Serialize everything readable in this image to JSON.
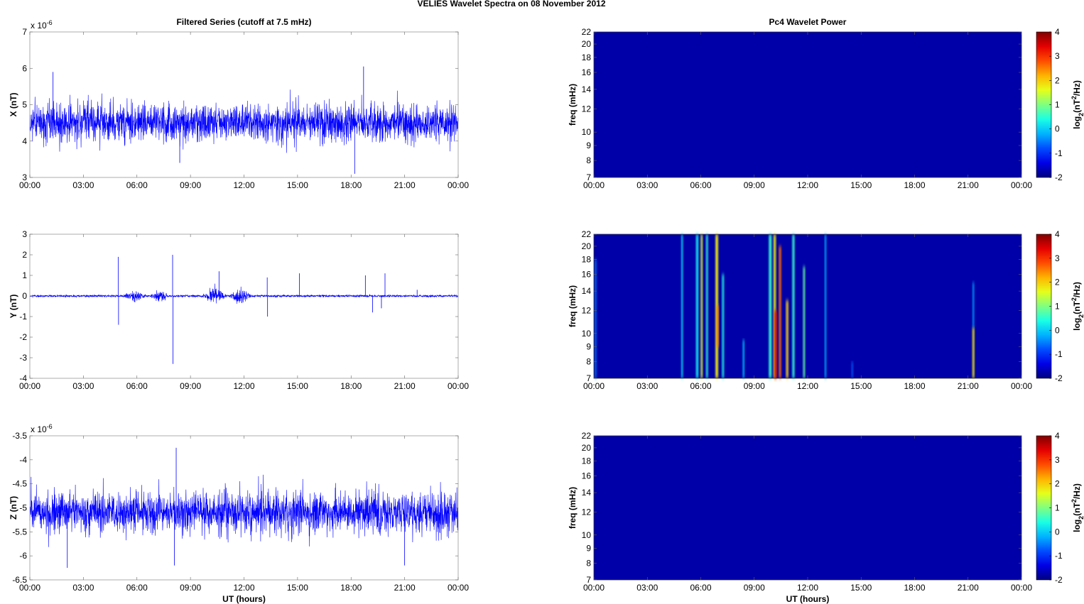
{
  "title": "VELIES Wavelet Spectra on 08 November  2012",
  "chart_data": [
    {
      "type": "line",
      "panel": "X",
      "title": "Filtered Series (cutoff at 7.5 mHz)",
      "ylabel": "X (nT)",
      "exponent_base": "x 10",
      "exponent": "-6",
      "xlabel": "",
      "xlim": [
        0,
        24
      ],
      "ylim": [
        3,
        7
      ],
      "yticks": [
        "3",
        "4",
        "5",
        "6",
        "7"
      ],
      "yvals": [
        3,
        4,
        5,
        6,
        7
      ],
      "xticks": [
        "00:00",
        "03:00",
        "06:00",
        "09:00",
        "12:00",
        "15:00",
        "18:00",
        "21:00",
        "00:00"
      ],
      "series_summary": {
        "mean": 4.5,
        "amplitude": 0.45,
        "spikes": [
          [
            1.3,
            5.9
          ],
          [
            18.2,
            3.1
          ],
          [
            18.7,
            6.05
          ],
          [
            8.4,
            3.4
          ]
        ]
      },
      "color": "#0000ff"
    },
    {
      "type": "line",
      "panel": "Y",
      "title": "",
      "ylabel": "Y (nT)",
      "exponent_base": "",
      "exponent": "",
      "xlabel": "",
      "xlim": [
        0,
        24
      ],
      "ylim": [
        -4,
        3
      ],
      "yticks": [
        "-4",
        "-3",
        "-2",
        "-1",
        "0",
        "1",
        "2",
        "3"
      ],
      "yvals": [
        -4,
        -3,
        -2,
        -1,
        0,
        1,
        2,
        3
      ],
      "xticks": [
        "00:00",
        "03:00",
        "06:00",
        "09:00",
        "12:00",
        "15:00",
        "18:00",
        "21:00",
        "00:00"
      ],
      "series_summary": {
        "mean": 0,
        "amplitude": 0.04,
        "bursts": [
          [
            5.3,
            7.8,
            0.3
          ],
          [
            9.6,
            12.4,
            0.45
          ]
        ],
        "spikes": [
          [
            4.95,
            1.9
          ],
          [
            4.97,
            -1.4
          ],
          [
            8.0,
            2.0
          ],
          [
            8.02,
            -3.3
          ],
          [
            10.6,
            1.2
          ],
          [
            13.3,
            0.9
          ],
          [
            13.32,
            -1.0
          ],
          [
            15.1,
            1.1
          ],
          [
            18.8,
            1.0
          ],
          [
            19.2,
            -0.8
          ],
          [
            19.9,
            1.1
          ],
          [
            19.7,
            -0.6
          ],
          [
            21.7,
            0.3
          ]
        ]
      },
      "color": "#0000ff"
    },
    {
      "type": "line",
      "panel": "Z",
      "title": "",
      "ylabel": "Z (nT)",
      "exponent_base": "x 10",
      "exponent": "-6",
      "xlabel": "UT (hours)",
      "xlim": [
        0,
        24
      ],
      "ylim": [
        -6.5,
        -3.5
      ],
      "yticks": [
        "-6.5",
        "-6",
        "-5.5",
        "-5",
        "-4.5",
        "-4",
        "-3.5"
      ],
      "yvals": [
        -6.5,
        -6,
        -5.5,
        -5,
        -4.5,
        -4,
        -3.5
      ],
      "xticks": [
        "00:00",
        "03:00",
        "06:00",
        "09:00",
        "12:00",
        "15:00",
        "18:00",
        "21:00",
        "00:00"
      ],
      "series_summary": {
        "mean": -5.1,
        "amplitude": 0.38,
        "spikes": [
          [
            8.2,
            -3.75
          ],
          [
            8.1,
            -6.2
          ],
          [
            2.1,
            -6.25
          ],
          [
            21.0,
            -6.2
          ]
        ]
      },
      "color": "#0000ff"
    },
    {
      "type": "heatmap",
      "panel": "X",
      "title": "Pc4 Wavelet Power",
      "ylabel": "freq (mHz)",
      "xlabel": "",
      "yscale": "log",
      "ylim": [
        7,
        22
      ],
      "yticks": [
        "7",
        "8",
        "9",
        "10",
        "12",
        "14",
        "16",
        "18",
        "20",
        "22"
      ],
      "yvals": [
        7,
        8,
        9,
        10,
        12,
        14,
        16,
        18,
        20,
        22
      ],
      "xticks": [
        "00:00",
        "03:00",
        "06:00",
        "09:00",
        "12:00",
        "15:00",
        "18:00",
        "21:00",
        "00:00"
      ],
      "colorbar": {
        "label": "log2(nT2/Hz)",
        "label_main": "log",
        "label_sub": "2",
        "label_mid": "(nT",
        "label_sup": "2",
        "label_end": "/Hz)",
        "ticks": [
          "4",
          "3",
          "2",
          "1",
          "0",
          "-1",
          "-2"
        ],
        "range": [
          -2,
          4
        ]
      },
      "background_power": -2,
      "events": []
    },
    {
      "type": "heatmap",
      "panel": "Y",
      "title": "",
      "ylabel": "freq (mHz)",
      "xlabel": "",
      "yscale": "log",
      "ylim": [
        7,
        22
      ],
      "yticks": [
        "7",
        "8",
        "9",
        "10",
        "12",
        "14",
        "16",
        "18",
        "20",
        "22"
      ],
      "yvals": [
        7,
        8,
        9,
        10,
        12,
        14,
        16,
        18,
        20,
        22
      ],
      "xticks": [
        "00:00",
        "03:00",
        "06:00",
        "09:00",
        "12:00",
        "15:00",
        "18:00",
        "21:00",
        "00:00"
      ],
      "colorbar": {
        "label": "log2(nT2/Hz)",
        "label_main": "log",
        "label_sub": "2",
        "label_mid": "(nT",
        "label_sup": "2",
        "label_end": "/Hz)",
        "ticks": [
          "4",
          "3",
          "2",
          "1",
          "0",
          "-1",
          "-2"
        ],
        "range": [
          -2,
          4
        ]
      },
      "background_power": -2,
      "events": [
        {
          "t": 0.1,
          "w": 0.08,
          "f": [
            7,
            18
          ],
          "p": -0.6
        },
        {
          "t": 4.95,
          "w": 0.06,
          "f": [
            7,
            22
          ],
          "p": 0.2
        },
        {
          "t": 5.8,
          "w": 0.12,
          "f": [
            7,
            22
          ],
          "p": 0.3
        },
        {
          "t": 6.05,
          "w": 0.1,
          "f": [
            7,
            22
          ],
          "p": 1.6
        },
        {
          "t": 6.35,
          "w": 0.1,
          "f": [
            7,
            22
          ],
          "p": 0.5
        },
        {
          "t": 6.9,
          "w": 0.14,
          "f": [
            7,
            22
          ],
          "p": 1.8
        },
        {
          "t": 6.95,
          "w": 0.1,
          "f": [
            9,
            12.5
          ],
          "p": 2.6
        },
        {
          "t": 7.25,
          "w": 0.1,
          "f": [
            7,
            16
          ],
          "p": 0.4
        },
        {
          "t": 8.4,
          "w": 0.06,
          "f": [
            7,
            9.5
          ],
          "p": 0
        },
        {
          "t": 9.9,
          "w": 0.15,
          "f": [
            7,
            22
          ],
          "p": 0.5
        },
        {
          "t": 10.15,
          "w": 0.12,
          "f": [
            7,
            22
          ],
          "p": 1.8
        },
        {
          "t": 10.2,
          "w": 0.12,
          "f": [
            7,
            12
          ],
          "p": 3.4
        },
        {
          "t": 10.45,
          "w": 0.12,
          "f": [
            7,
            20
          ],
          "p": 2.7
        },
        {
          "t": 10.85,
          "w": 0.12,
          "f": [
            7,
            13
          ],
          "p": 2.0
        },
        {
          "t": 11.2,
          "w": 0.12,
          "f": [
            7,
            22
          ],
          "p": 0.5
        },
        {
          "t": 11.8,
          "w": 0.1,
          "f": [
            7,
            17
          ],
          "p": 0.8
        },
        {
          "t": 13.0,
          "w": 0.06,
          "f": [
            7,
            22
          ],
          "p": -0.2
        },
        {
          "t": 14.5,
          "w": 0.06,
          "f": [
            7,
            8
          ],
          "p": -0.8
        },
        {
          "t": 21.3,
          "w": 0.1,
          "f": [
            7,
            10.5
          ],
          "p": 1.8
        },
        {
          "t": 21.3,
          "w": 0.06,
          "f": [
            10.5,
            15
          ],
          "p": -0.3
        }
      ]
    },
    {
      "type": "heatmap",
      "panel": "Z",
      "title": "",
      "ylabel": "freq (mHz)",
      "xlabel": "UT (hours)",
      "yscale": "log",
      "ylim": [
        7,
        22
      ],
      "yticks": [
        "7",
        "8",
        "9",
        "10",
        "12",
        "14",
        "16",
        "18",
        "20",
        "22"
      ],
      "yvals": [
        7,
        8,
        9,
        10,
        12,
        14,
        16,
        18,
        20,
        22
      ],
      "xticks": [
        "00:00",
        "03:00",
        "06:00",
        "09:00",
        "12:00",
        "15:00",
        "18:00",
        "21:00",
        "00:00"
      ],
      "colorbar": {
        "label": "log2(nT2/Hz)",
        "label_main": "log",
        "label_sub": "2",
        "label_mid": "(nT",
        "label_sup": "2",
        "label_end": "/Hz)",
        "ticks": [
          "4",
          "3",
          "2",
          "1",
          "0",
          "-1",
          "-2"
        ],
        "range": [
          -2,
          4
        ]
      },
      "background_power": -2,
      "events": []
    }
  ]
}
